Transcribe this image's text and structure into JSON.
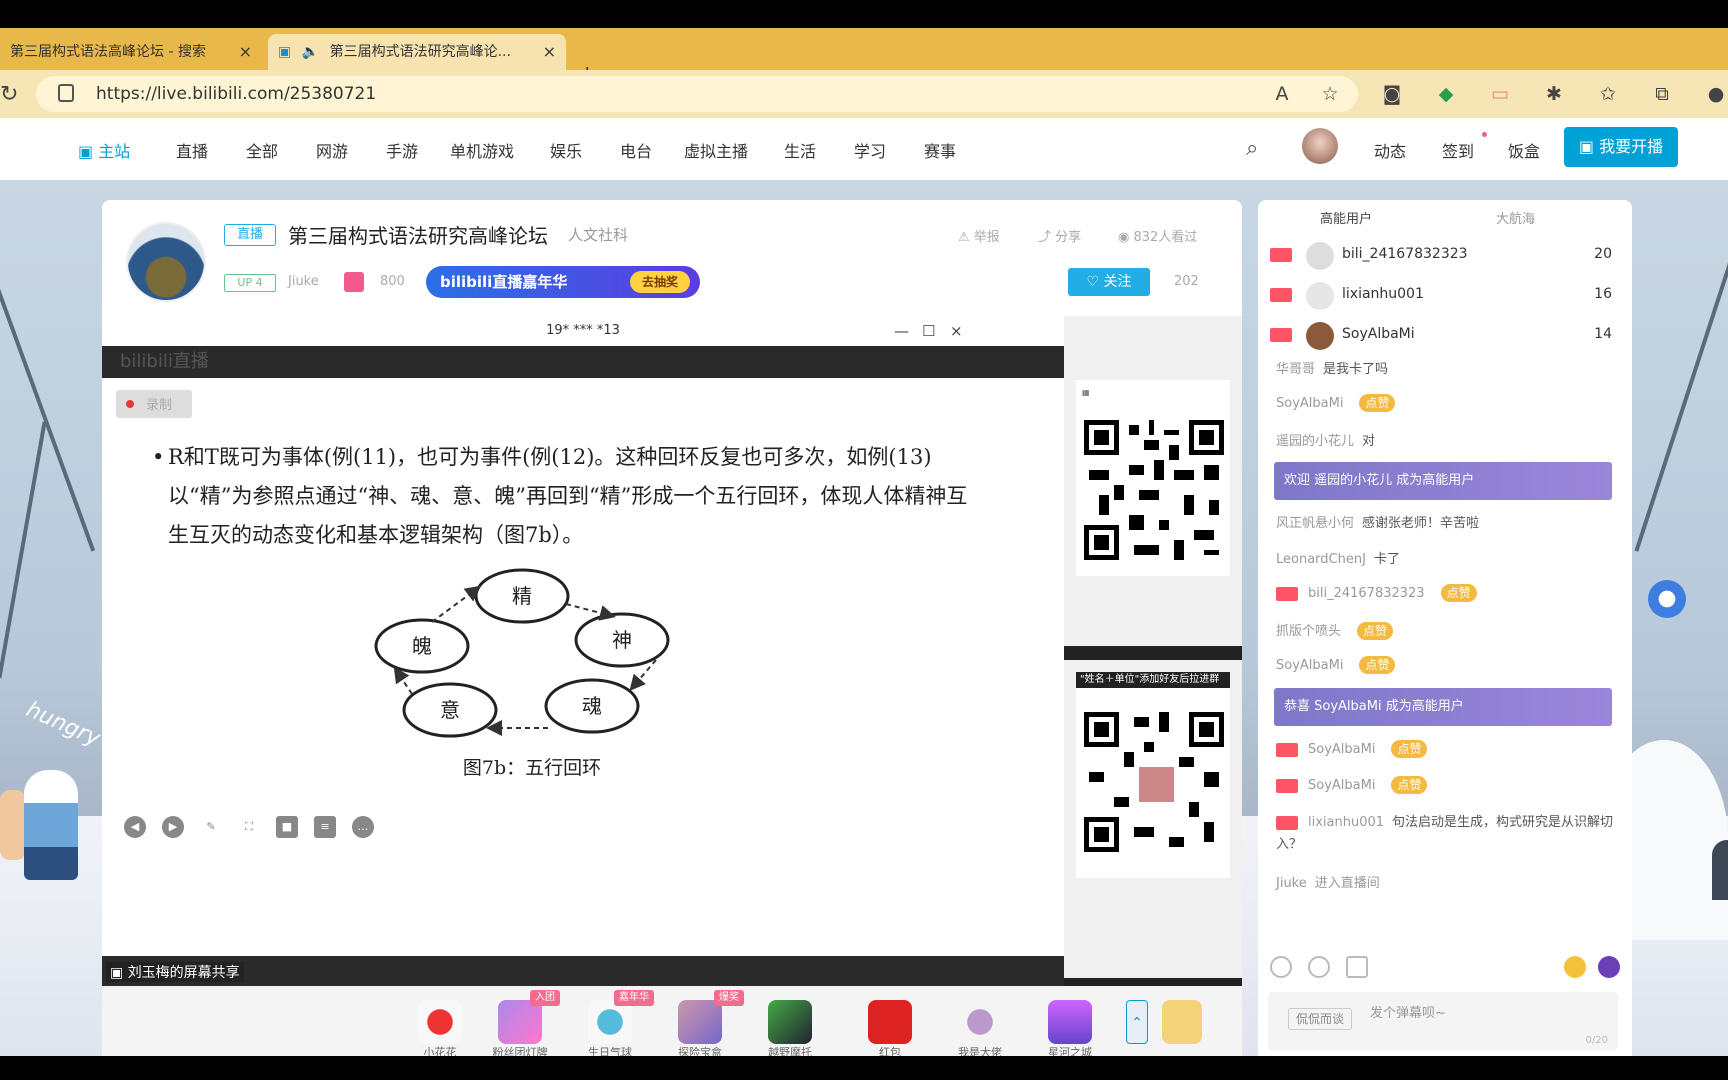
{
  "browser": {
    "tabs": [
      {
        "title": "第三届构式语法高峰论坛 - 搜索"
      },
      {
        "title": "第三届构式语法研究高峰论..."
      }
    ],
    "url": "https://live.bilibili.com/25380721"
  },
  "nav": {
    "items": [
      "主站",
      "直播",
      "全部",
      "网游",
      "手游",
      "单机游戏",
      "娱乐",
      "电台",
      "虚拟主播",
      "生活",
      "学习",
      "赛事"
    ],
    "right": [
      "动态",
      "签到",
      "饭盒"
    ],
    "start_label": "我要开播"
  },
  "room": {
    "live_badge": "直播",
    "title": "第三届构式语法研究高峰论坛",
    "category": "人文社科",
    "report": "举报",
    "share": "分享",
    "viewers": "832人看过",
    "up_level": "UP 4",
    "up_name": "Jiuke",
    "gift_count": "800",
    "banner": "bilibili直播嘉年华",
    "banner_go": "去抽奖",
    "follow_label": "关注",
    "followers": "202"
  },
  "share": {
    "window_title": "19* *** *13",
    "dark_label": "bilibili直播",
    "rec_label": "录制",
    "slide_text": "R和T既可为事体(例(11)，也可为事件(例(12)。这种回环反复也可多次，如例(13)以“精”为参照点通过“神、魂、意、魄”再回到“精”形成一个五行回环，体现人体精神互生互灭的动态变化和基本逻辑架构（图7b）。",
    "diagram_nodes": [
      "精",
      "神",
      "魂",
      "意",
      "魄"
    ],
    "diagram_caption": "图7b：五行回环",
    "sharer": "刘玉梅的屏幕共享",
    "qr2_tag": "\"姓名＋单位\"添加好友后拉进群"
  },
  "gifts": [
    {
      "name": "小花花",
      "badge": ""
    },
    {
      "name": "粉丝团灯牌",
      "badge": "入团"
    },
    {
      "name": "生日气球",
      "badge": "嘉年华"
    },
    {
      "name": "探险宝盒",
      "badge": "爆奖"
    },
    {
      "name": "越野摩托",
      "badge": ""
    },
    {
      "name": "红包",
      "badge": ""
    },
    {
      "name": "我是大佬",
      "badge": ""
    },
    {
      "name": "星河之城",
      "badge": ""
    }
  ],
  "chat": {
    "tabs": [
      "高能用户",
      "大航海"
    ],
    "ranks": [
      {
        "name": "bili_24167832323",
        "score": "20"
      },
      {
        "name": "lixianhu001",
        "score": "16"
      },
      {
        "name": "SoyAlbaMi",
        "score": "14"
      }
    ],
    "messages": [
      {
        "user": "华哥哥",
        "text": "是我卡了吗",
        "dz": ""
      },
      {
        "user": "SoyAlbaMi",
        "text": "",
        "dz": "点赞"
      },
      {
        "user": "遥园的小花儿",
        "text": "对",
        "dz": ""
      },
      {
        "sys": true,
        "text": "欢迎 遥园的小花儿 成为高能用户"
      },
      {
        "user": "风正帆悬小何",
        "text": "感谢张老师！辛苦啦",
        "dz": ""
      },
      {
        "user": "LeonardChenJ",
        "text": "卡了",
        "dz": ""
      },
      {
        "user": "bili_24167832323",
        "text": "",
        "dz": "点赞"
      },
      {
        "user": "抓版个喷头",
        "text": "",
        "dz": "点赞"
      },
      {
        "user": "SoyAlbaMi",
        "text": "",
        "dz": "点赞"
      },
      {
        "sys": true,
        "text": "恭喜 SoyAlbaMi 成为高能用户"
      },
      {
        "user": "SoyAlbaMi",
        "text": "",
        "dz": "点赞"
      },
      {
        "user": "SoyAlbaMi",
        "text": "",
        "dz": "点赞"
      },
      {
        "user": "lixianhu001",
        "text": "句法启动是生成，构式研究是从识解切入？",
        "dz": ""
      },
      {
        "user": "Jiuke",
        "text": "进入直播间",
        "dz": ""
      }
    ],
    "input_button": "侃侃而谈",
    "input_placeholder": "发个弹幕呗~",
    "counter": "0/20"
  }
}
